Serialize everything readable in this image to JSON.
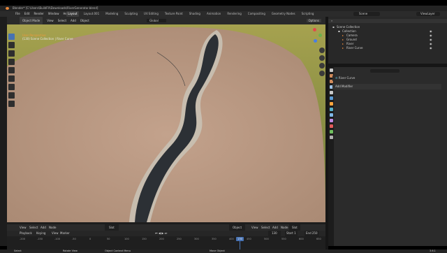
{
  "window": {
    "title": "Blender* [C:\\Users\\BuildFX\\Downloads\\RiverGenerator.blend]"
  },
  "menubar": {
    "items": [
      "File",
      "Edit",
      "Render",
      "Window",
      "Help"
    ],
    "workspaces": [
      "Layout",
      "Layout.001",
      "Modeling",
      "Sculpting",
      "UV Editing",
      "Texture Paint",
      "Shading",
      "Animation",
      "Rendering",
      "Compositing",
      "Geometry Nodes",
      "Scripting"
    ],
    "active_workspace": "Layout",
    "scene_label": "Scene",
    "view_layer_label": "ViewLayer"
  },
  "viewport_header": {
    "mode": "Object Mode",
    "items": [
      "View",
      "Select",
      "Add",
      "Object"
    ],
    "orientation": "Global",
    "options": "Options"
  },
  "viewport_overlay": {
    "line1": "User Perspective",
    "line2": "(130) Scene Collection | River Curve"
  },
  "bottom_editor": {
    "items": [
      "View",
      "Select",
      "Add",
      "Node"
    ],
    "node_field": "Slot",
    "object_label": "Object",
    "right_items": [
      "View",
      "Select",
      "Add",
      "Node"
    ],
    "slot_field": "Slot"
  },
  "timeline": {
    "playback_items": [
      "Playback",
      "Keying",
      "View",
      "Marker"
    ],
    "current_frame": "130",
    "start_label": "Start",
    "start_value": "1",
    "end_label": "End",
    "end_value": "250",
    "ruler": [
      "-200",
      "-150",
      "-100",
      "-50",
      "0",
      "50",
      "100",
      "150",
      "200",
      "250",
      "300",
      "350",
      "400",
      "450",
      "500",
      "550",
      "600",
      "650"
    ],
    "playhead": "130"
  },
  "outliner": {
    "title": "Scene Collection",
    "rows": [
      {
        "label": "Collection",
        "indent": 1
      },
      {
        "label": "Camera",
        "indent": 2
      },
      {
        "label": "Ground",
        "indent": 2
      },
      {
        "label": "River",
        "indent": 2
      },
      {
        "label": "River Curve",
        "indent": 2
      }
    ]
  },
  "properties": {
    "object_name": "River Curve",
    "add_modifier": "Add Modifier",
    "tab_colors": [
      "#c9c9c9",
      "#d08a5a",
      "#d08a5a",
      "#9ec2e6",
      "#c8c8c8",
      "#5b9bd5",
      "#ffa53d",
      "#56b0c9",
      "#7fb8e8",
      "#bf8ce6",
      "#e35b5b",
      "#6fbf5f",
      "#b0b0b0"
    ]
  },
  "statusbar": {
    "left": "Select",
    "middle": "Rotate View",
    "right": "Object Context Menu",
    "center_right": "Move Object",
    "version": "3.6.1"
  },
  "colors": {
    "accent": "#4772b3",
    "river": "#2c3035",
    "terrain": "#bc9a84",
    "grass": "#8b8c44"
  }
}
